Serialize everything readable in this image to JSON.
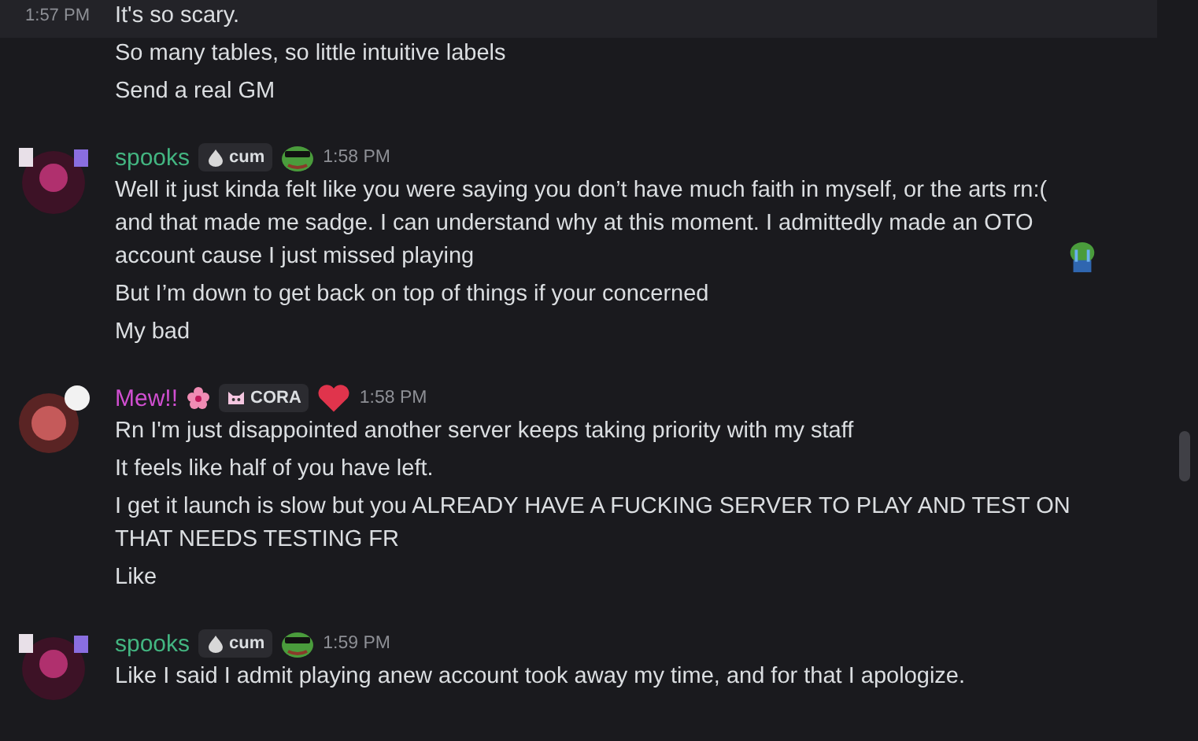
{
  "messages": [
    {
      "continuation": true,
      "time": "1:57 PM",
      "lines": [
        {
          "text": "It's so scary."
        }
      ]
    },
    {
      "continuation": true,
      "lines": [
        {
          "text": "So many tables, so little intuitive labels"
        },
        {
          "text": "Send a real GM"
        }
      ]
    },
    {
      "kind": "frog",
      "author": "spooks",
      "color": "#43b581",
      "badge": "cum",
      "time": "1:58 PM",
      "lines": [
        {
          "text": "Well it just kinda felt like you were saying you don’t have much faith in myself, or the arts rn:( and that made me sadge. I can understand why at this moment. I admittedly made an OTO account cause I just missed playing",
          "emoji": true
        },
        {
          "text": "But I’m down to get back on top of things if your concerned"
        },
        {
          "text": "My bad"
        }
      ]
    },
    {
      "kind": "heart",
      "author": "Mew!!",
      "color": "#d14fd1",
      "badge": "CORA",
      "time": "1:58 PM",
      "lines": [
        {
          "text": "Rn I'm just disappointed another server keeps taking priority with my staff"
        },
        {
          "text": "It feels like half of you have left."
        },
        {
          "text": "I get it launch is slow but you ALREADY HAVE A FUCKING SERVER TO PLAY AND TEST ON THAT NEEDS TESTING FR"
        },
        {
          "text": "Like"
        }
      ]
    },
    {
      "kind": "frog",
      "author": "spooks",
      "color": "#43b581",
      "badge": "cum",
      "time": "1:59 PM",
      "lines": [
        {
          "text": "Like I said I admit playing anew account took away my time, and for that I apologize."
        }
      ]
    }
  ]
}
